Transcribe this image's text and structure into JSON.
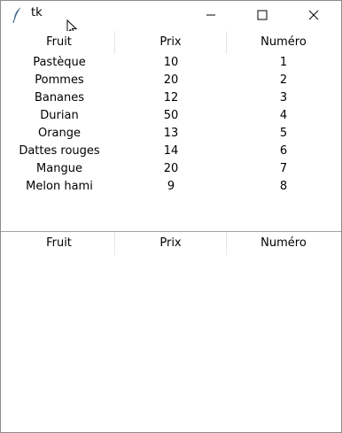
{
  "window": {
    "title": "tk"
  },
  "table_top": {
    "columns": [
      "Fruit",
      "Prix",
      "Numéro"
    ],
    "rows": [
      [
        "Pastèque",
        "10",
        "1"
      ],
      [
        "Pommes",
        "20",
        "2"
      ],
      [
        "Bananes",
        "12",
        "3"
      ],
      [
        "Durian",
        "50",
        "4"
      ],
      [
        "Orange",
        "13",
        "5"
      ],
      [
        "Dattes rouges",
        "14",
        "6"
      ],
      [
        "Mangue",
        "20",
        "7"
      ],
      [
        "Melon hami",
        "9",
        "8"
      ]
    ]
  },
  "table_bottom": {
    "columns": [
      "Fruit",
      "Prix",
      "Numéro"
    ],
    "rows": []
  },
  "icons": {
    "app": "feather-icon",
    "minimize": "minimize-icon",
    "maximize": "maximize-icon",
    "close": "close-icon",
    "cursor": "mouse-cursor-icon"
  }
}
